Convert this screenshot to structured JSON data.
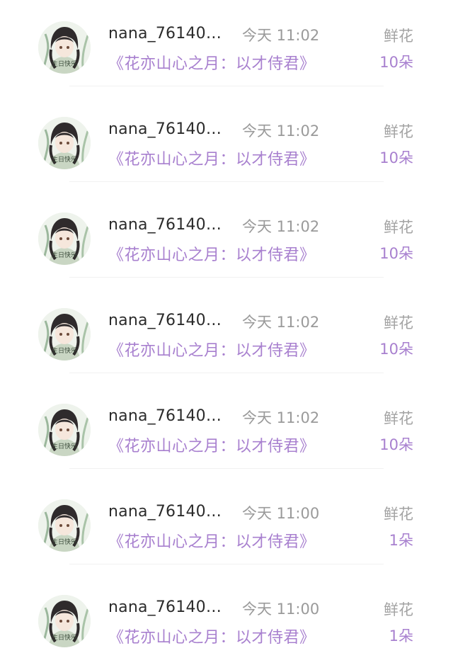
{
  "rows": [
    {
      "username": "nana_761406...",
      "time": "今天 11:02",
      "gift_type": "鲜花",
      "book_title": "《花亦山心之月：以才侍君》",
      "gift_count": "10朵",
      "avatar_text": "生日快乐"
    },
    {
      "username": "nana_761406...",
      "time": "今天 11:02",
      "gift_type": "鲜花",
      "book_title": "《花亦山心之月：以才侍君》",
      "gift_count": "10朵",
      "avatar_text": "生日快乐"
    },
    {
      "username": "nana_761406...",
      "time": "今天 11:02",
      "gift_type": "鲜花",
      "book_title": "《花亦山心之月：以才侍君》",
      "gift_count": "10朵",
      "avatar_text": "生日快乐"
    },
    {
      "username": "nana_761406...",
      "time": "今天 11:02",
      "gift_type": "鲜花",
      "book_title": "《花亦山心之月：以才侍君》",
      "gift_count": "10朵",
      "avatar_text": "生日快乐"
    },
    {
      "username": "nana_761406...",
      "time": "今天 11:02",
      "gift_type": "鲜花",
      "book_title": "《花亦山心之月：以才侍君》",
      "gift_count": "10朵",
      "avatar_text": "生日快乐"
    },
    {
      "username": "nana_761406...",
      "time": "今天 11:00",
      "gift_type": "鲜花",
      "book_title": "《花亦山心之月：以才侍君》",
      "gift_count": "1朵",
      "avatar_text": "生日快乐"
    },
    {
      "username": "nana_761406...",
      "time": "今天 11:00",
      "gift_type": "鲜花",
      "book_title": "《花亦山心之月：以才侍君》",
      "gift_count": "1朵",
      "avatar_text": "生日快乐"
    }
  ],
  "colors": {
    "accent": "#a880cf",
    "username": "#2b2b2b",
    "muted": "#9a9a9a",
    "avatar_bg": "#eef3ec",
    "avatar_hair": "#2f2b2c"
  }
}
